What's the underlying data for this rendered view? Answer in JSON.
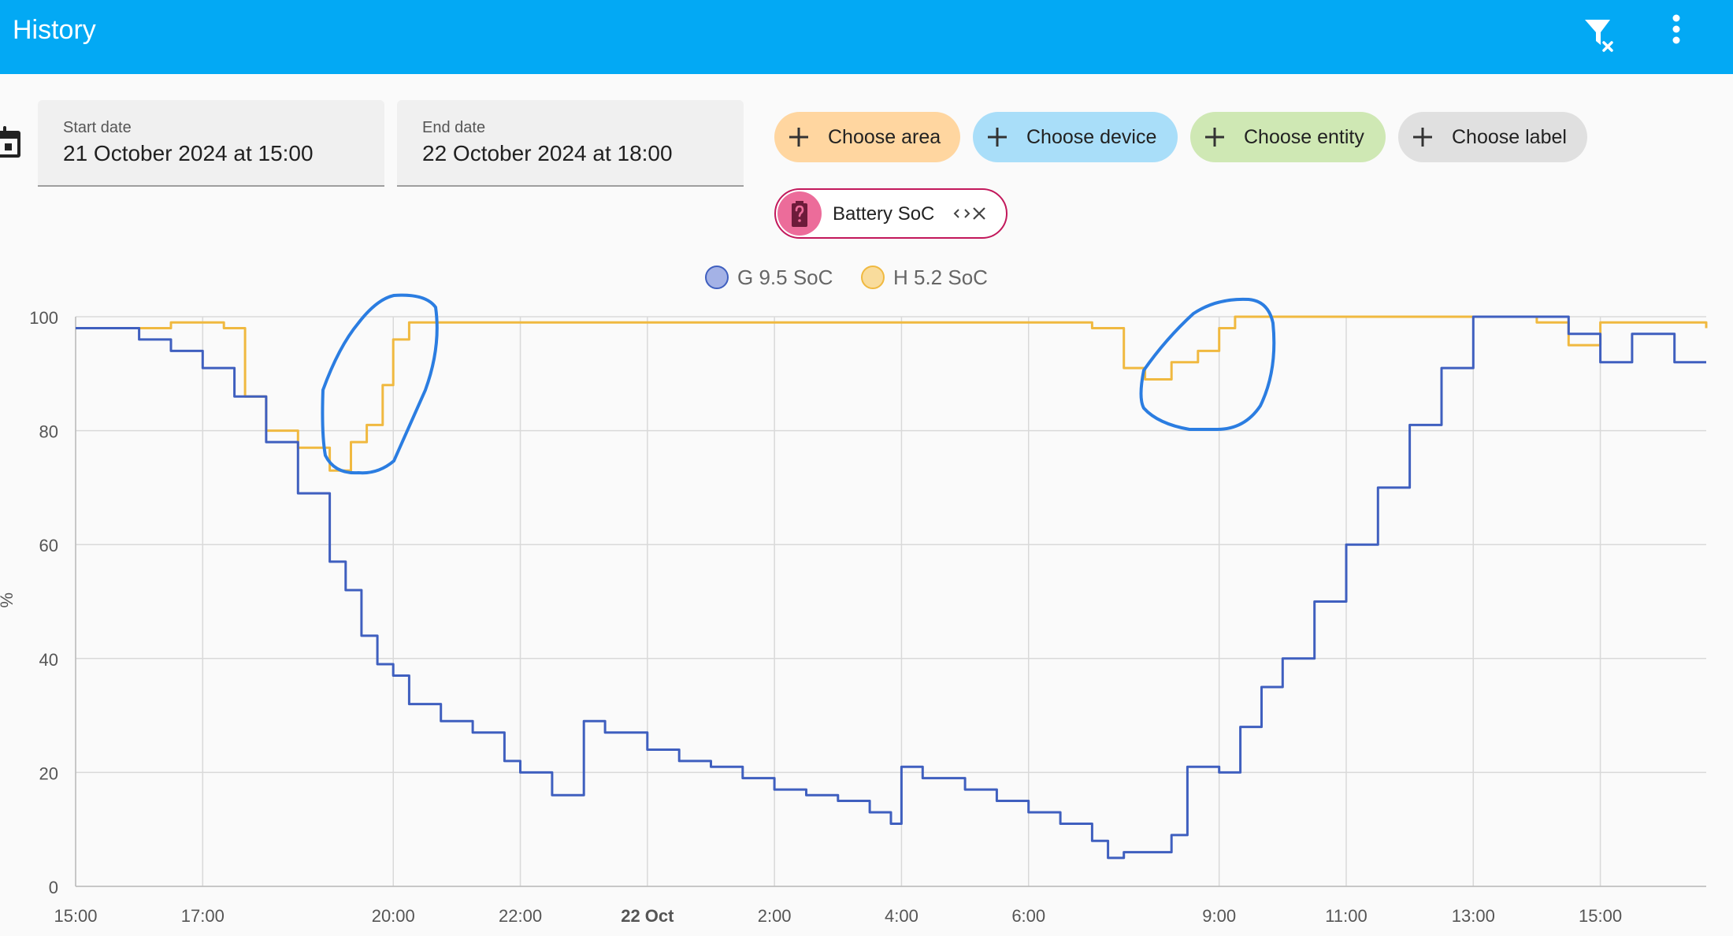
{
  "header": {
    "title": "History",
    "actions": [
      {
        "icon": "filter-remove-icon"
      },
      {
        "icon": "more-vert-icon"
      }
    ]
  },
  "start_date": {
    "label": "Start date",
    "value": "21 October 2024 at 15:00"
  },
  "end_date": {
    "label": "End date",
    "value": "22 October 2024 at 18:00"
  },
  "target_chips": [
    {
      "label": "Choose area",
      "color": "#ffd6a0"
    },
    {
      "label": "Choose device",
      "color": "#a9def9"
    },
    {
      "label": "Choose entity",
      "color": "#cfe8b4"
    },
    {
      "label": "Choose label",
      "color": "#e0e0e0"
    }
  ],
  "entity_chip": {
    "label": "Battery SoC",
    "color": "#c2185b"
  },
  "chart_data": {
    "type": "line",
    "y_unit": "%",
    "ylim": [
      0,
      100
    ],
    "yticks": [
      0,
      20,
      40,
      60,
      80,
      100
    ],
    "xlim": [
      "2024-10-21 15:00",
      "2024-10-22 16:40"
    ],
    "xticks": [
      {
        "t": "2024-10-21 15:00",
        "label": "15:00",
        "bold": false
      },
      {
        "t": "2024-10-21 17:00",
        "label": "17:00",
        "bold": false
      },
      {
        "t": "2024-10-21 20:00",
        "label": "20:00",
        "bold": false
      },
      {
        "t": "2024-10-21 22:00",
        "label": "22:00",
        "bold": false
      },
      {
        "t": "2024-10-22 00:00",
        "label": "22 Oct",
        "bold": true
      },
      {
        "t": "2024-10-22 02:00",
        "label": "2:00",
        "bold": false
      },
      {
        "t": "2024-10-22 04:00",
        "label": "4:00",
        "bold": false
      },
      {
        "t": "2024-10-22 06:00",
        "label": "6:00",
        "bold": false
      },
      {
        "t": "2024-10-22 09:00",
        "label": "9:00",
        "bold": false
      },
      {
        "t": "2024-10-22 11:00",
        "label": "11:00",
        "bold": false
      },
      {
        "t": "2024-10-22 13:00",
        "label": "13:00",
        "bold": false
      },
      {
        "t": "2024-10-22 15:00",
        "label": "15:00",
        "bold": false
      }
    ],
    "grid": true,
    "legend_position": "top",
    "series": [
      {
        "name": "G 9.5 SoC",
        "color": "#3f5fbf",
        "legend_fill": "#a4b2e6",
        "points": [
          [
            "2024-10-21 15:00",
            98
          ],
          [
            "2024-10-21 15:45",
            98
          ],
          [
            "2024-10-21 16:00",
            96
          ],
          [
            "2024-10-21 16:30",
            94
          ],
          [
            "2024-10-21 17:00",
            91
          ],
          [
            "2024-10-21 17:30",
            86
          ],
          [
            "2024-10-21 18:00",
            78
          ],
          [
            "2024-10-21 18:30",
            69
          ],
          [
            "2024-10-21 19:00",
            57
          ],
          [
            "2024-10-21 19:15",
            52
          ],
          [
            "2024-10-21 19:30",
            44
          ],
          [
            "2024-10-21 19:45",
            39
          ],
          [
            "2024-10-21 20:00",
            37
          ],
          [
            "2024-10-21 20:15",
            32
          ],
          [
            "2024-10-21 20:45",
            29
          ],
          [
            "2024-10-21 21:15",
            27
          ],
          [
            "2024-10-21 21:45",
            22
          ],
          [
            "2024-10-21 22:00",
            20
          ],
          [
            "2024-10-21 22:30",
            16
          ],
          [
            "2024-10-21 23:00",
            29
          ],
          [
            "2024-10-21 23:20",
            27
          ],
          [
            "2024-10-22 00:00",
            24
          ],
          [
            "2024-10-22 00:30",
            22
          ],
          [
            "2024-10-22 01:00",
            21
          ],
          [
            "2024-10-22 01:30",
            19
          ],
          [
            "2024-10-22 02:00",
            17
          ],
          [
            "2024-10-22 02:30",
            16
          ],
          [
            "2024-10-22 03:00",
            15
          ],
          [
            "2024-10-22 03:30",
            13
          ],
          [
            "2024-10-22 03:50",
            11
          ],
          [
            "2024-10-22 04:00",
            21
          ],
          [
            "2024-10-22 04:20",
            19
          ],
          [
            "2024-10-22 05:00",
            17
          ],
          [
            "2024-10-22 05:30",
            15
          ],
          [
            "2024-10-22 06:00",
            13
          ],
          [
            "2024-10-22 06:30",
            11
          ],
          [
            "2024-10-22 07:00",
            8
          ],
          [
            "2024-10-22 07:15",
            5
          ],
          [
            "2024-10-22 07:30",
            6
          ],
          [
            "2024-10-22 08:00",
            6
          ],
          [
            "2024-10-22 08:15",
            9
          ],
          [
            "2024-10-22 08:30",
            21
          ],
          [
            "2024-10-22 09:00",
            20
          ],
          [
            "2024-10-22 09:20",
            28
          ],
          [
            "2024-10-22 09:40",
            35
          ],
          [
            "2024-10-22 10:00",
            40
          ],
          [
            "2024-10-22 10:30",
            50
          ],
          [
            "2024-10-22 11:00",
            60
          ],
          [
            "2024-10-22 11:30",
            70
          ],
          [
            "2024-10-22 12:00",
            81
          ],
          [
            "2024-10-22 12:30",
            91
          ],
          [
            "2024-10-22 13:00",
            100
          ],
          [
            "2024-10-22 14:00",
            100
          ],
          [
            "2024-10-22 14:30",
            97
          ],
          [
            "2024-10-22 15:00",
            92
          ],
          [
            "2024-10-22 15:30",
            97
          ],
          [
            "2024-10-22 16:10",
            92
          ],
          [
            "2024-10-22 16:40",
            92
          ]
        ]
      },
      {
        "name": "H 5.2 SoC",
        "color": "#f0b940",
        "legend_fill": "#f9dc9c",
        "points": [
          [
            "2024-10-21 15:00",
            98
          ],
          [
            "2024-10-21 16:30",
            99
          ],
          [
            "2024-10-21 17:20",
            98
          ],
          [
            "2024-10-21 17:40",
            86
          ],
          [
            "2024-10-21 18:00",
            80
          ],
          [
            "2024-10-21 18:30",
            77
          ],
          [
            "2024-10-21 19:00",
            73
          ],
          [
            "2024-10-21 19:20",
            78
          ],
          [
            "2024-10-21 19:35",
            81
          ],
          [
            "2024-10-21 19:50",
            88
          ],
          [
            "2024-10-21 20:00",
            96
          ],
          [
            "2024-10-21 20:15",
            99
          ],
          [
            "2024-10-21 21:00",
            99
          ],
          [
            "2024-10-22 07:00",
            98
          ],
          [
            "2024-10-22 07:30",
            91
          ],
          [
            "2024-10-22 07:50",
            89
          ],
          [
            "2024-10-22 08:15",
            92
          ],
          [
            "2024-10-22 08:40",
            94
          ],
          [
            "2024-10-22 09:00",
            98
          ],
          [
            "2024-10-22 09:15",
            100
          ],
          [
            "2024-10-22 13:00",
            100
          ],
          [
            "2024-10-22 14:00",
            99
          ],
          [
            "2024-10-22 14:30",
            95
          ],
          [
            "2024-10-22 15:00",
            99
          ],
          [
            "2024-10-22 16:40",
            98
          ]
        ]
      }
    ]
  }
}
